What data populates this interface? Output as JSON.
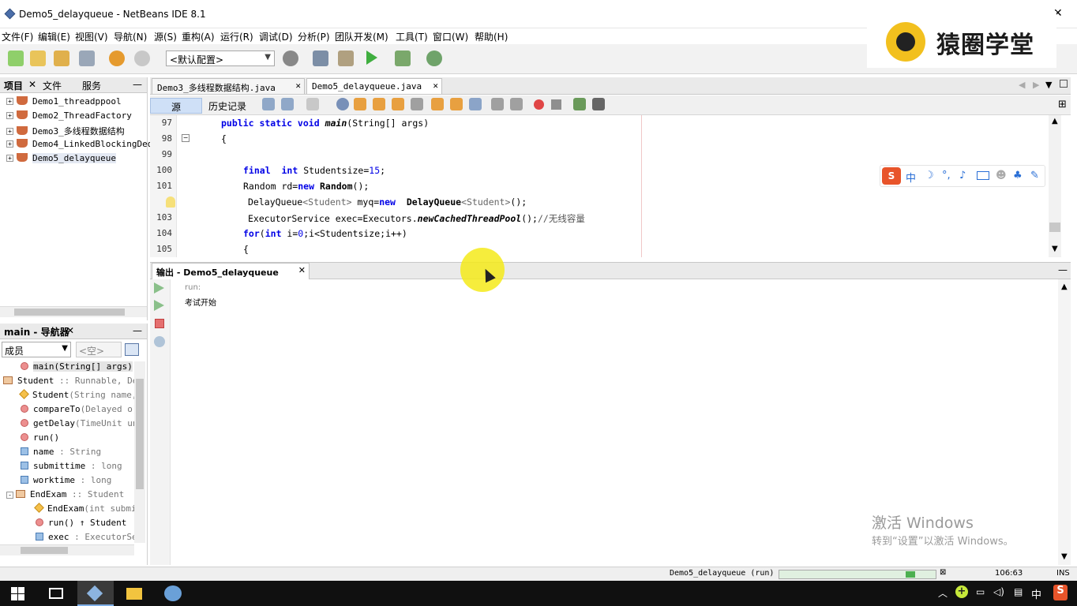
{
  "window": {
    "title": "Demo5_delayqueue - NetBeans IDE 8.1"
  },
  "menu": [
    "文件(F)",
    "编辑(E)",
    "视图(V)",
    "导航(N)",
    "源(S)",
    "重构(A)",
    "运行(R)",
    "调试(D)",
    "分析(P)",
    "团队开发(M)",
    "工具(T)",
    "窗口(W)",
    "帮助(H)"
  ],
  "logo": {
    "text": "猿圈学堂"
  },
  "toolbar": {
    "config": "<默认配置>"
  },
  "projects": {
    "tabs": [
      "项目",
      "文件",
      "服务"
    ],
    "items": [
      "Demo1_threadppool",
      "Demo2_ThreadFactory",
      "Demo3_多线程数据结构",
      "Demo4_LinkedBlockingDequ",
      "Demo5_delayqueue"
    ]
  },
  "navigator": {
    "title": "main - 导航器",
    "filter": "成员",
    "filter2": "<空>",
    "items": [
      {
        "name": "main(String[] args)",
        "type": ""
      },
      {
        "name": "Student",
        "type": " :: Runnable, Del"
      },
      {
        "name": "Student",
        "type": "(String name,"
      },
      {
        "name": "compareTo",
        "type": "(Delayed o)"
      },
      {
        "name": "getDelay",
        "type": "(TimeUnit uni"
      },
      {
        "name": "run()",
        "type": ""
      },
      {
        "name": "name",
        "type": " : String"
      },
      {
        "name": "submittime",
        "type": " : long"
      },
      {
        "name": "worktime",
        "type": " : long"
      },
      {
        "name": "EndExam",
        "type": " :: Student"
      },
      {
        "name": "EndExam",
        "type": "(int submi"
      },
      {
        "name": "run()",
        "type": " ↑ Student"
      },
      {
        "name": "exec",
        "type": " : ExecutorSer"
      }
    ]
  },
  "editor": {
    "tabs": [
      "Demo3_多线程数据结构.java",
      "Demo5_delayqueue.java"
    ],
    "source_tab": "源",
    "history_tab": "历史记录",
    "line_numbers": [
      "97",
      "98",
      "99",
      "100",
      "101",
      "",
      "103",
      "104",
      "105"
    ]
  },
  "output": {
    "tab": "输出 - Demo5_delayqueue (run)",
    "lines": [
      "run:",
      "考试开始"
    ]
  },
  "status": {
    "task": "Demo5_delayqueue (run)",
    "position": "106:63",
    "mode": "INS"
  },
  "watermark": {
    "line1": "激活 Windows",
    "line2": "转到“设置”以激活 Windows。"
  },
  "taskbar": {
    "ime": "中"
  }
}
